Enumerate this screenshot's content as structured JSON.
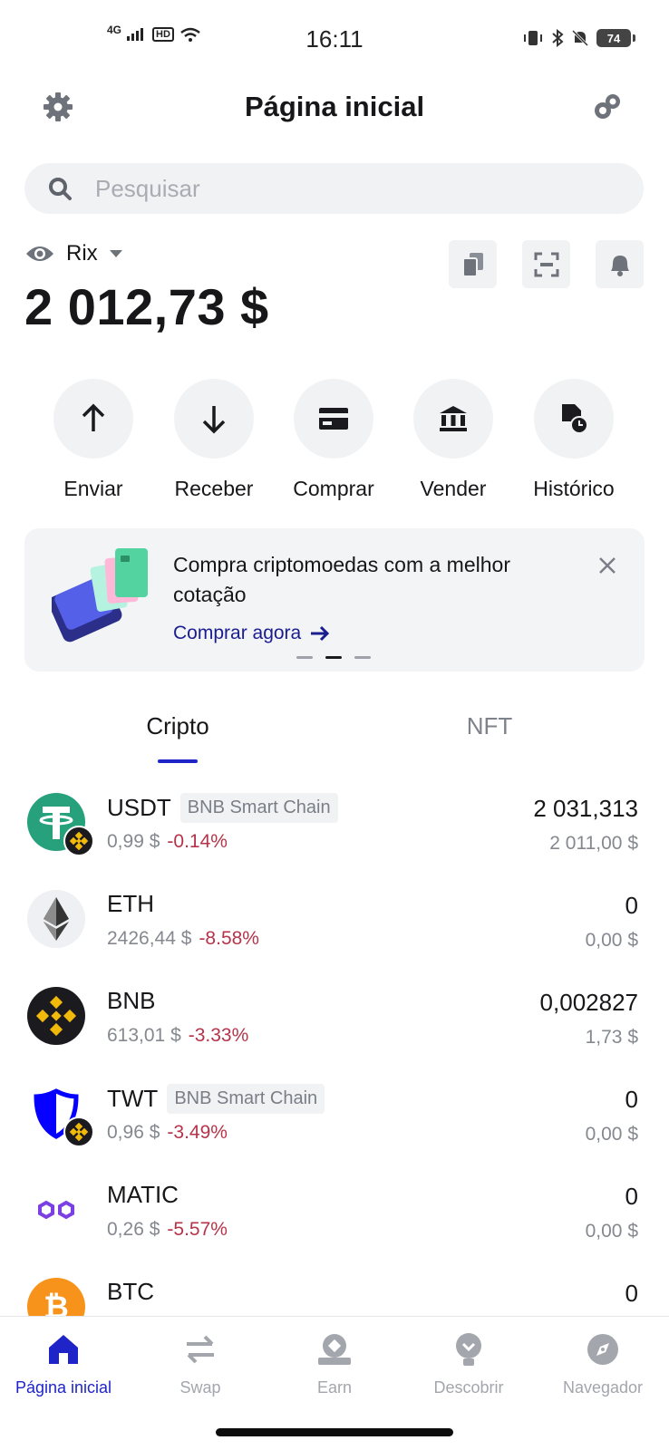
{
  "status_bar": {
    "time": "16:11",
    "network": "4G",
    "hd_label": "HD",
    "battery": "74"
  },
  "header": {
    "title": "Página inicial",
    "left_icon": "gear-icon",
    "right_icon": "link-icon"
  },
  "search": {
    "placeholder": "Pesquisar"
  },
  "wallet": {
    "name": "Rix",
    "balance": "2 012,73 $"
  },
  "actions": [
    {
      "label": "Enviar",
      "icon": "arrow-up-icon"
    },
    {
      "label": "Receber",
      "icon": "arrow-down-icon"
    },
    {
      "label": "Comprar",
      "icon": "card-icon"
    },
    {
      "label": "Vender",
      "icon": "bank-icon"
    },
    {
      "label": "Histórico",
      "icon": "history-icon"
    }
  ],
  "promo": {
    "text": "Compra criptomoedas com a melhor cotação",
    "link": "Comprar agora"
  },
  "tabs": [
    {
      "label": "Cripto",
      "active": true
    },
    {
      "label": "NFT",
      "active": false
    }
  ],
  "assets": [
    {
      "symbol": "USDT",
      "chain": "BNB Smart Chain",
      "price": "0,99 $",
      "change": "-0.14%",
      "quantity": "2 031,313",
      "fiat": "2 011,00 $"
    },
    {
      "symbol": "ETH",
      "chain": "",
      "price": "2426,44 $",
      "change": "-8.58%",
      "quantity": "0",
      "fiat": "0,00 $"
    },
    {
      "symbol": "BNB",
      "chain": "",
      "price": "613,01 $",
      "change": "-3.33%",
      "quantity": "0,002827",
      "fiat": "1,73 $"
    },
    {
      "symbol": "TWT",
      "chain": "BNB Smart Chain",
      "price": "0,96 $",
      "change": "-3.49%",
      "quantity": "0",
      "fiat": "0,00 $"
    },
    {
      "symbol": "MATIC",
      "chain": "",
      "price": "0,26 $",
      "change": "-5.57%",
      "quantity": "0",
      "fiat": "0,00 $"
    },
    {
      "symbol": "BTC",
      "chain": "",
      "price": "",
      "change": "",
      "quantity": "0",
      "fiat": ""
    }
  ],
  "bottom_nav": [
    {
      "label": "Página inicial",
      "active": true
    },
    {
      "label": "Swap",
      "active": false
    },
    {
      "label": "Earn",
      "active": false
    },
    {
      "label": "Descobrir",
      "active": false
    },
    {
      "label": "Navegador",
      "active": false
    }
  ],
  "colors": {
    "accent": "#1f24c9",
    "negative": "#b5344a",
    "link": "#1a1d8f"
  }
}
